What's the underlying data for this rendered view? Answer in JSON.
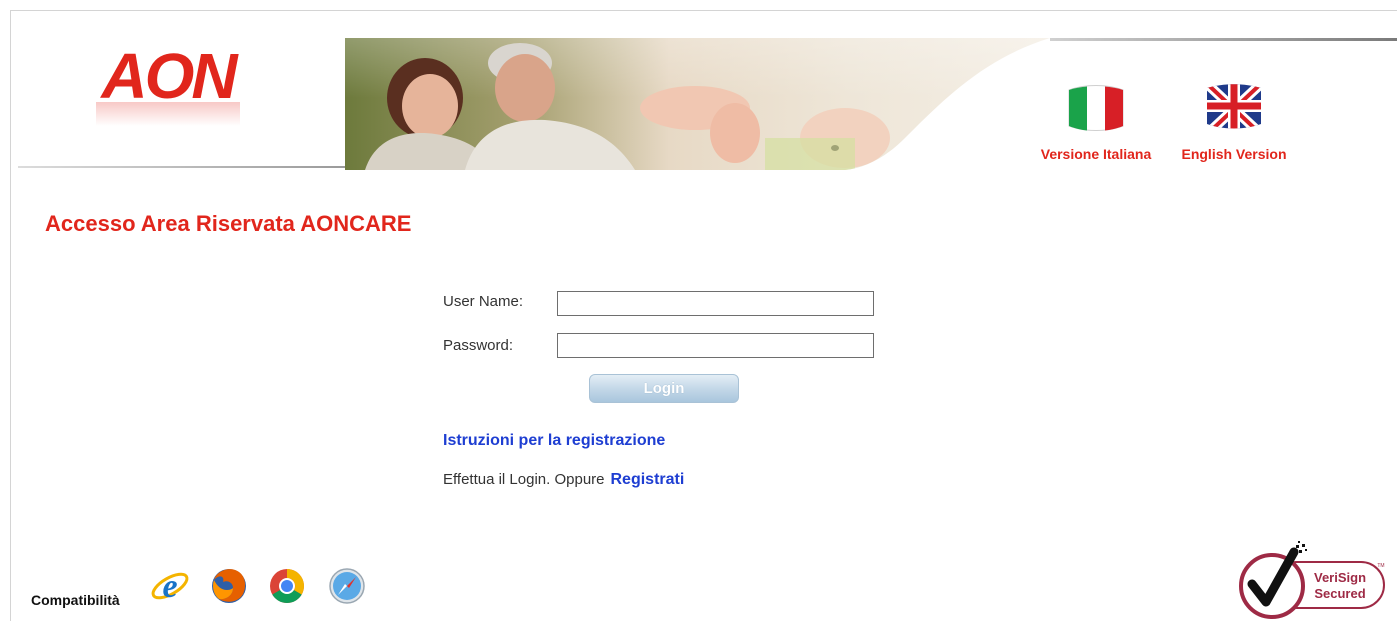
{
  "brand": {
    "logo_text": "AON"
  },
  "language": {
    "italian_label": "Versione Italiana",
    "english_label": "English Version",
    "italian_icon": "italy-flag-icon",
    "english_icon": "uk-flag-icon"
  },
  "page": {
    "title": "Accesso Area Riservata AONCARE"
  },
  "login_form": {
    "username_label": "User Name:",
    "username_value": "",
    "password_label": "Password:",
    "password_value": "",
    "login_button": "Login"
  },
  "links": {
    "instructions": "Istruzioni per la registrazione",
    "register_prompt": "Effettua il Login. Oppure",
    "register_link": "Registrati"
  },
  "footer": {
    "compat_label": "Compatibilità",
    "browsers": [
      "internet-explorer-icon",
      "firefox-icon",
      "chrome-icon",
      "safari-icon"
    ],
    "verisign_line1": "VeriSign",
    "verisign_line2": "Secured",
    "verisign_tm": "TM"
  },
  "colors": {
    "brand_red": "#e1261c",
    "link_blue": "#1e3ed2",
    "verisign_maroon": "#9e2a45"
  }
}
